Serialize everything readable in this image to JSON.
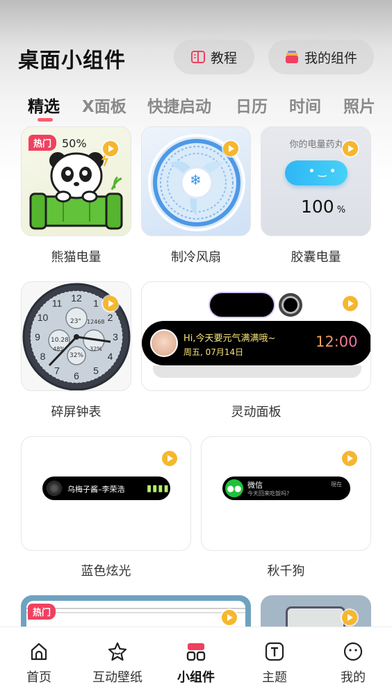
{
  "header": {
    "title": "桌面小组件",
    "tutorial_label": "教程",
    "my_widgets_label": "我的组件"
  },
  "tabs": [
    {
      "label": "精选",
      "active": true
    },
    {
      "label": "X面板"
    },
    {
      "label": "快捷启动"
    },
    {
      "label": "日历"
    },
    {
      "label": "时间"
    },
    {
      "label": "照片"
    }
  ],
  "widgets": {
    "panda": {
      "label": "熊猫电量",
      "badge": "热门",
      "battery": "50%"
    },
    "fan": {
      "label": "制冷风扇"
    },
    "capsule": {
      "label": "胶囊电量",
      "caption": "你的电量药丸",
      "value": "100",
      "unit": "%"
    },
    "clock": {
      "label": "碎屏钟表",
      "numerals": [
        "12",
        "1",
        "2",
        "3",
        "4",
        "5",
        "6",
        "7",
        "8",
        "9",
        "10",
        "11"
      ],
      "sub_temp": "23°",
      "sub_steps": "12468",
      "sub_date": "10.28",
      "sub_left": "48%",
      "sub_center": "32%",
      "sub_right": "32%"
    },
    "dynamic": {
      "label": "灵动面板",
      "greeting": "Hi,今天要元气满满哦~",
      "date": "周五, 07月14日",
      "time": "12:00"
    },
    "blue": {
      "label": "蓝色炫光",
      "song": "乌梅子酱–李荣浩"
    },
    "swing": {
      "label": "秋千狗",
      "app": "微信",
      "status": "現在",
      "message": "今天回来吃饭吗?"
    },
    "row4": {
      "badge": "热门"
    }
  },
  "bottom_nav": [
    {
      "label": "首页",
      "icon": "home-icon"
    },
    {
      "label": "互动壁纸",
      "icon": "star-icon"
    },
    {
      "label": "小组件",
      "icon": "widgets-icon",
      "active": true
    },
    {
      "label": "主题",
      "icon": "theme-icon"
    },
    {
      "label": "我的",
      "icon": "profile-icon"
    }
  ],
  "colors": {
    "accent": "#f04060",
    "play": "#f5b72e",
    "tab_active": "#111111",
    "tab_inactive": "#8a8a8a"
  }
}
